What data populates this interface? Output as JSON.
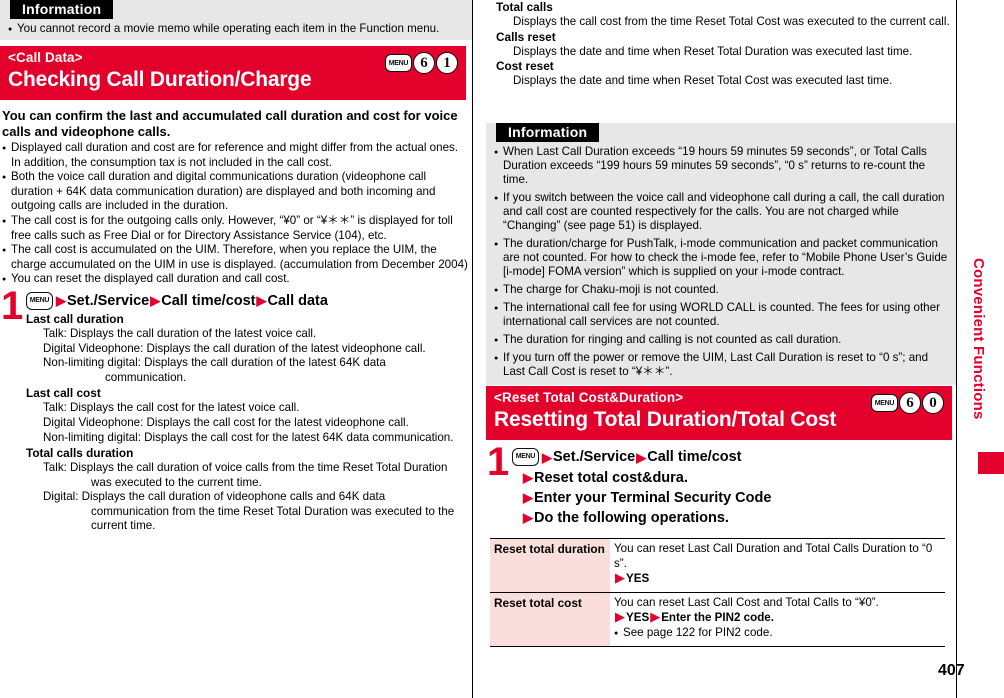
{
  "page": {
    "number": "407",
    "edge_tab_label": "Convenient Functions",
    "accent_red": "#e3002b",
    "info_bg": "#e7e7e7",
    "table_name_bg": "#fadedb"
  },
  "left": {
    "top_info": {
      "title": "Information",
      "items": [
        "You cannot record a movie memo while operating each item in the Function menu."
      ]
    },
    "section": {
      "subtitle": "<Call Data>",
      "title": "Checking Call Duration/Charge",
      "keys": {
        "menu": "MENU",
        "k1": "6",
        "k2": "1"
      }
    },
    "lead": "You can confirm the last and accumulated call duration and cost for voice calls and videophone calls.",
    "bullets": [
      "Displayed call duration and cost are for reference and might differ from the actual ones. In addition, the consumption tax is not included in the call cost.",
      "Both the voice call duration and digital communications duration (videophone call duration + 64K data communication duration) are displayed and both incoming and outgoing calls are included in the duration.",
      "The call cost is for the outgoing calls only. However, “¥0” or “¥＊＊” is displayed for toll free calls such as Free Dial or for Directory Assistance Service (104), etc.",
      "The call cost is accumulated on the UIM. Therefore, when you replace the UIM, the charge accumulated on the UIM in use is displayed. (accumulation from December 2004)",
      "You can reset the displayed call duration and call cost."
    ],
    "step": {
      "number": "1",
      "menu_key": "MENU",
      "path": [
        "Set./Service",
        "Call time/cost",
        "Call data"
      ]
    },
    "definitions": [
      {
        "term": "Last call duration",
        "lines": [
          {
            "text": "Talk: Displays the call duration of the latest voice call."
          },
          {
            "text": "Digital Videophone: Displays the call duration of the latest videophone call."
          },
          {
            "text": "Non-limiting digital: Displays the call duration of the latest 64K data",
            "cont": "communication."
          }
        ]
      },
      {
        "term": "Last call cost",
        "lines": [
          {
            "text": "Talk: Displays the call cost for the latest voice call."
          },
          {
            "text": "Digital Videophone: Displays the call cost for the latest videophone call."
          },
          {
            "text": "Non-limiting digital: Displays the call cost for the latest 64K data communication."
          }
        ]
      },
      {
        "term": "Total calls duration",
        "lines": [
          {
            "text": "Talk: Displays the call duration of voice calls from the time Reset Total Duration",
            "cont2": "was executed to the current time."
          },
          {
            "text": "Digital: Displays the call duration of videophone calls and 64K data",
            "cont2": "communication from the time Reset Total Duration was executed to the current time."
          }
        ]
      }
    ]
  },
  "right": {
    "definitions_cont": [
      {
        "term": "Total calls",
        "desc": "Displays the call cost from the time Reset Total Cost was executed to the current call."
      },
      {
        "term": "Calls reset",
        "desc": "Displays the date and time when Reset Total Duration was executed last time."
      },
      {
        "term": "Cost reset",
        "desc": "Displays the date and time when Reset Total Cost was executed last time."
      }
    ],
    "info": {
      "title": "Information",
      "items": [
        "When Last Call Duration exceeds “19 hours 59 minutes 59 seconds”, or Total Calls Duration exceeds “199 hours 59 minutes 59 seconds”, “0 s” returns to re-count the time.",
        "If you switch between the voice call and videophone call during a call, the call duration and call cost are counted respectively for the calls. You are not charged while “Changing” (see page 51) is displayed.",
        "The duration/charge for PushTalk, i-mode communication and packet communication are not counted. For how to check the i-mode fee, refer to “Mobile Phone User’s Guide [i-mode] FOMA version” which is supplied on your i-mode contract.",
        "The charge for Chaku-moji is not counted.",
        "The international call fee for using WORLD CALL is counted. The fees for using other international call services are not counted.",
        "The duration for ringing and calling is not counted as call duration.",
        "If you turn off the power or remove the UIM, Last Call Duration is reset to “0 s”; and Last Call Cost is reset to “¥＊＊”."
      ]
    },
    "section": {
      "subtitle": "<Reset Total Cost&Duration>",
      "title": "Resetting Total Duration/Total Cost",
      "keys": {
        "menu": "MENU",
        "k1": "6",
        "k2": "0"
      }
    },
    "step": {
      "number": "1",
      "menu_key": "MENU",
      "line1": [
        "Set./Service",
        "Call time/cost"
      ],
      "line2": "Reset total cost&dura.",
      "line3": "Enter your Terminal Security Code",
      "line4": "Do the following operations."
    },
    "table": {
      "rows": [
        {
          "name": "Reset total duration",
          "desc": "You can reset Last Call Duration and Total Calls Duration to “0 s”.",
          "action": "YES",
          "action2": "",
          "note": ""
        },
        {
          "name": "Reset total cost",
          "desc": "You can reset Last Call Cost and Total Calls to “¥0”.",
          "action": "YES",
          "action2": "Enter the PIN2 code.",
          "note": "See page 122 for PIN2 code."
        }
      ]
    }
  }
}
